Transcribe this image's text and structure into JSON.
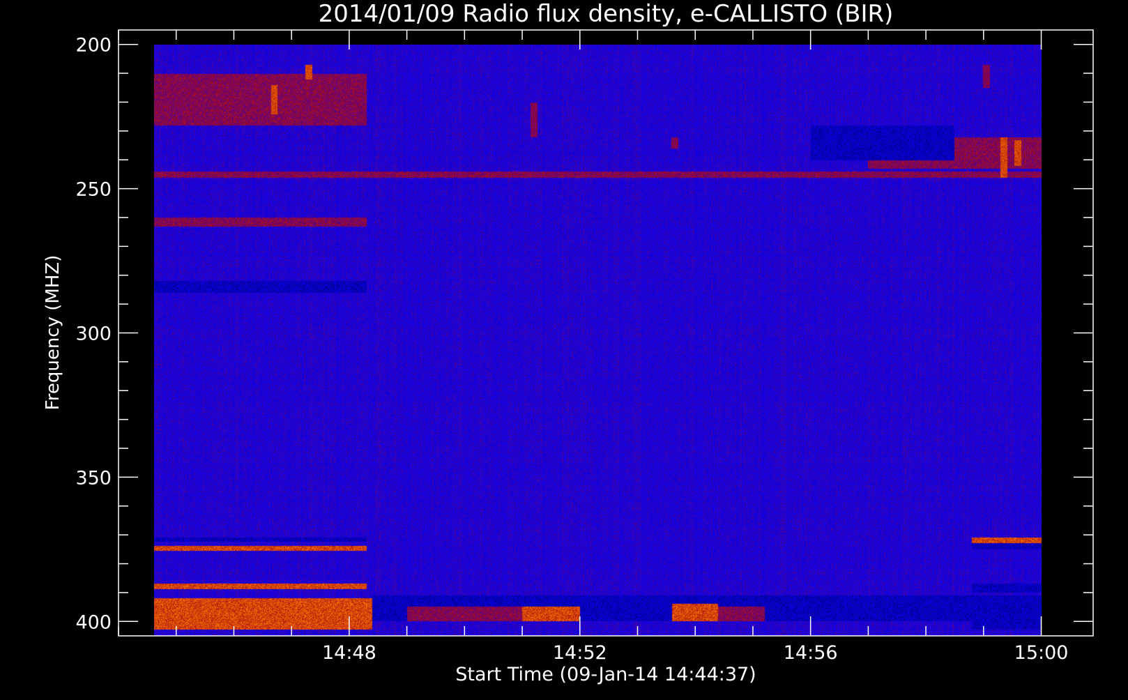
{
  "chart_data": {
    "type": "heatmap",
    "title": "2014/01/09  Radio flux density, e-CALLISTO (BIR)",
    "xlabel": "Start Time (09-Jan-14 14:44:37)",
    "ylabel": "Frequency (MHZ)",
    "x_start": "14:44:37",
    "x_end": "15:00:00",
    "xlim_minutes_after_1444": [
      0,
      16.9
    ],
    "ylim": [
      405,
      195
    ],
    "y_inverted": true,
    "x_tick_labels": [
      "14:48",
      "14:52",
      "14:56",
      "15:00"
    ],
    "x_tick_minutes_after_1444": [
      4,
      8,
      12,
      16
    ],
    "y_tick_labels": [
      "200",
      "250",
      "300",
      "350",
      "400"
    ],
    "y_tick_values": [
      200,
      250,
      300,
      350,
      400
    ],
    "data_range": {
      "time_minutes_after_1444": [
        0.62,
        16.0
      ],
      "frequency_mhz": [
        200,
        405
      ]
    },
    "grid": false,
    "legend": "none",
    "colormap": [
      "#000000",
      "#1a0aa8",
      "#0a00ff",
      "#7a1040",
      "#c01000",
      "#ff6010",
      "#ffff80"
    ],
    "features": [
      {
        "type": "band",
        "t_minutes": [
          0.62,
          4.3
        ],
        "freq_mhz": [
          394,
          399
        ],
        "level": "very-high"
      },
      {
        "type": "band",
        "t_minutes": [
          0.62,
          4.4
        ],
        "freq_mhz": [
          392,
          403
        ],
        "level": "high"
      },
      {
        "type": "band",
        "t_minutes": [
          0.62,
          4.3
        ],
        "freq_mhz": [
          387,
          389
        ],
        "level": "high"
      },
      {
        "type": "band",
        "t_minutes": [
          0.62,
          4.3
        ],
        "freq_mhz": [
          374,
          375.5
        ],
        "level": "high"
      },
      {
        "type": "band",
        "t_minutes": [
          0.62,
          4.3
        ],
        "freq_mhz": [
          371,
          372.5
        ],
        "level": "low"
      },
      {
        "type": "band",
        "t_minutes": [
          4.4,
          16.0
        ],
        "freq_mhz": [
          391,
          400
        ],
        "level": "low"
      },
      {
        "type": "band",
        "t_minutes": [
          14.8,
          16.0
        ],
        "freq_mhz": [
          392,
          403
        ],
        "level": "low"
      },
      {
        "type": "band",
        "t_minutes": [
          14.8,
          16.0
        ],
        "freq_mhz": [
          387,
          390
        ],
        "level": "low"
      },
      {
        "type": "band",
        "t_minutes": [
          14.8,
          16.0
        ],
        "freq_mhz": [
          373,
          375
        ],
        "level": "low"
      },
      {
        "type": "band",
        "t_minutes": [
          14.8,
          16.0
        ],
        "freq_mhz": [
          371,
          373
        ],
        "level": "high"
      },
      {
        "type": "band",
        "t_minutes": [
          0.62,
          4.3
        ],
        "freq_mhz": [
          210,
          228
        ],
        "level": "medium"
      },
      {
        "type": "band",
        "t_minutes": [
          13.0,
          16.0
        ],
        "freq_mhz": [
          232,
          243
        ],
        "level": "medium"
      },
      {
        "type": "band",
        "t_minutes": [
          0.62,
          4.3
        ],
        "freq_mhz": [
          260,
          263
        ],
        "level": "medium"
      },
      {
        "type": "band",
        "t_minutes": [
          0.62,
          16.0
        ],
        "freq_mhz": [
          244,
          246
        ],
        "level": "medium"
      },
      {
        "type": "band",
        "t_minutes": [
          0.62,
          4.3
        ],
        "freq_mhz": [
          282,
          286
        ],
        "level": "low"
      },
      {
        "type": "band",
        "t_minutes": [
          5.0,
          7.0
        ],
        "freq_mhz": [
          395,
          400
        ],
        "level": "medium"
      },
      {
        "type": "band",
        "t_minutes": [
          7.0,
          8.0
        ],
        "freq_mhz": [
          395,
          400
        ],
        "level": "high"
      },
      {
        "type": "band",
        "t_minutes": [
          9.6,
          10.4
        ],
        "freq_mhz": [
          394,
          400
        ],
        "level": "high"
      },
      {
        "type": "band",
        "t_minutes": [
          10.4,
          11.2
        ],
        "freq_mhz": [
          395,
          400
        ],
        "level": "medium"
      },
      {
        "type": "band",
        "t_minutes": [
          12.0,
          14.5
        ],
        "freq_mhz": [
          228,
          240
        ],
        "level": "low"
      },
      {
        "type": "burst",
        "t_minutes": 2.7,
        "freq_mhz": [
          214,
          224
        ],
        "level": "high"
      },
      {
        "type": "burst",
        "t_minutes": 3.3,
        "freq_mhz": [
          207,
          212
        ],
        "level": "high"
      },
      {
        "type": "burst",
        "t_minutes": 7.2,
        "freq_mhz": [
          220,
          232
        ],
        "level": "medium"
      },
      {
        "type": "burst",
        "t_minutes": 15.35,
        "freq_mhz": [
          232,
          246
        ],
        "level": "high"
      },
      {
        "type": "burst",
        "t_minutes": 15.6,
        "freq_mhz": [
          233,
          242
        ],
        "level": "high"
      },
      {
        "type": "burst",
        "t_minutes": 15.05,
        "freq_mhz": [
          207,
          215
        ],
        "level": "medium"
      },
      {
        "type": "burst",
        "t_minutes": 9.65,
        "freq_mhz": [
          232,
          236
        ],
        "level": "medium"
      }
    ]
  }
}
